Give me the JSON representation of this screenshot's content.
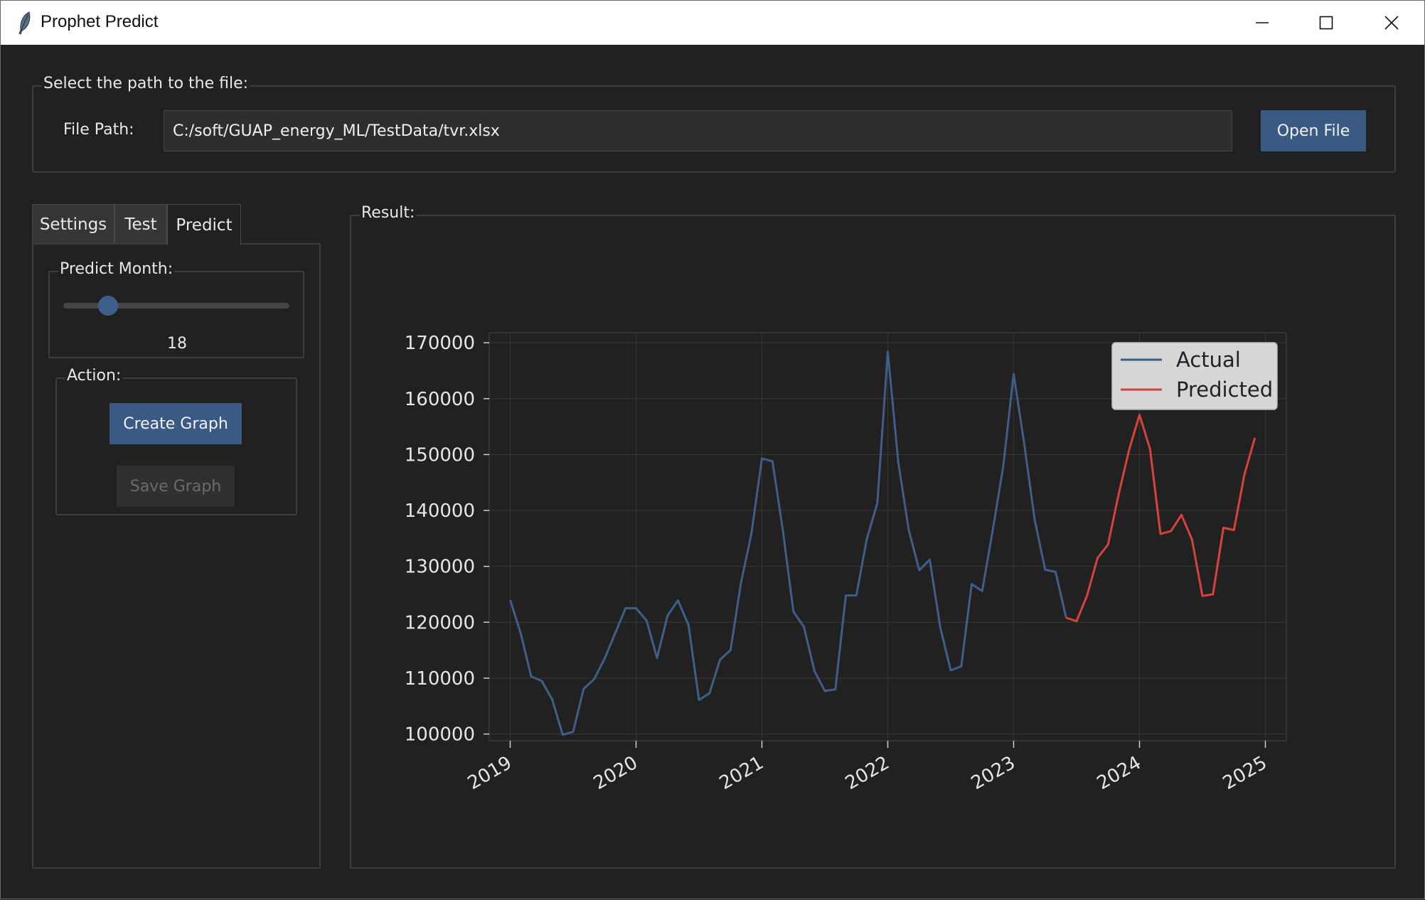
{
  "window": {
    "title": "Prophet Predict",
    "icon": "feather-icon"
  },
  "file_group": {
    "legend": "Select the path to the file:",
    "file_path_label": "File Path:",
    "file_path_value": "C:/soft/GUAP_energy_ML/TestData/tvr.xlsx",
    "open_button": "Open File"
  },
  "tabs": [
    {
      "label": "Settings",
      "active": false
    },
    {
      "label": "Test",
      "active": false
    },
    {
      "label": "Predict",
      "active": true
    }
  ],
  "predict_panel": {
    "predict_month_legend": "Predict Month:",
    "predict_month_value": "18",
    "predict_month_fraction": 0.17,
    "action_legend": "Action:",
    "create_graph_button": "Create Graph",
    "save_graph_button": "Save Graph"
  },
  "result": {
    "legend": "Result:"
  },
  "colors": {
    "background": "#212121",
    "accent": "#3a5a85",
    "actual_line": "#3f5f8a",
    "predicted_line": "#d9423a"
  },
  "chart_data": {
    "type": "line",
    "title": "",
    "xlabel": "",
    "ylabel": "",
    "grid": true,
    "legend_position": "top-right",
    "x_ticks": [
      "2019",
      "2020",
      "2021",
      "2022",
      "2023",
      "2024",
      "2025"
    ],
    "y_ticks": [
      "100000",
      "110000",
      "120000",
      "130000",
      "140000",
      "150000",
      "160000",
      "170000"
    ],
    "xlim": [
      "2018-11",
      "2025-03"
    ],
    "ylim": [
      98800,
      171800
    ],
    "series": [
      {
        "name": "Actual",
        "color": "#3f5f8a",
        "x": [
          "2019-01",
          "2019-02",
          "2019-03",
          "2019-04",
          "2019-05",
          "2019-06",
          "2019-07",
          "2019-08",
          "2019-09",
          "2019-10",
          "2019-11",
          "2019-12",
          "2020-01",
          "2020-02",
          "2020-03",
          "2020-04",
          "2020-05",
          "2020-06",
          "2020-07",
          "2020-08",
          "2020-09",
          "2020-10",
          "2020-11",
          "2020-12",
          "2021-01",
          "2021-02",
          "2021-03",
          "2021-04",
          "2021-05",
          "2021-06",
          "2021-07",
          "2021-08",
          "2021-09",
          "2021-10",
          "2021-11",
          "2021-12",
          "2022-01",
          "2022-02",
          "2022-03",
          "2022-04",
          "2022-05",
          "2022-06",
          "2022-07",
          "2022-08",
          "2022-09",
          "2022-10",
          "2022-11",
          "2022-12",
          "2023-01",
          "2023-02",
          "2023-03",
          "2023-04",
          "2023-05",
          "2023-06"
        ],
        "y": [
          124000,
          118000,
          110300,
          109500,
          106200,
          99900,
          100400,
          108100,
          109800,
          113500,
          118000,
          122500,
          122500,
          120300,
          113600,
          121200,
          123900,
          119500,
          106100,
          107300,
          113300,
          115000,
          127000,
          135900,
          149300,
          148800,
          136400,
          121900,
          119200,
          111300,
          107700,
          108000,
          124800,
          124800,
          134900,
          141300,
          168400,
          148600,
          136500,
          129300,
          131200,
          119100,
          111400,
          112100,
          126800,
          125600,
          136400,
          147800,
          164400,
          152000,
          138400,
          129400,
          129000,
          120800
        ]
      },
      {
        "name": "Predicted",
        "color": "#d9423a",
        "x": [
          "2023-06",
          "2023-07",
          "2023-08",
          "2023-09",
          "2023-10",
          "2023-11",
          "2023-12",
          "2024-01",
          "2024-02",
          "2024-03",
          "2024-04",
          "2024-05",
          "2024-06",
          "2024-07",
          "2024-08",
          "2024-09",
          "2024-10",
          "2024-11",
          "2024-12"
        ],
        "y": [
          120800,
          120200,
          124800,
          131500,
          133900,
          142800,
          150800,
          157100,
          151000,
          135800,
          136300,
          139200,
          134800,
          124700,
          125000,
          136900,
          136500,
          146400,
          153000
        ]
      }
    ]
  }
}
